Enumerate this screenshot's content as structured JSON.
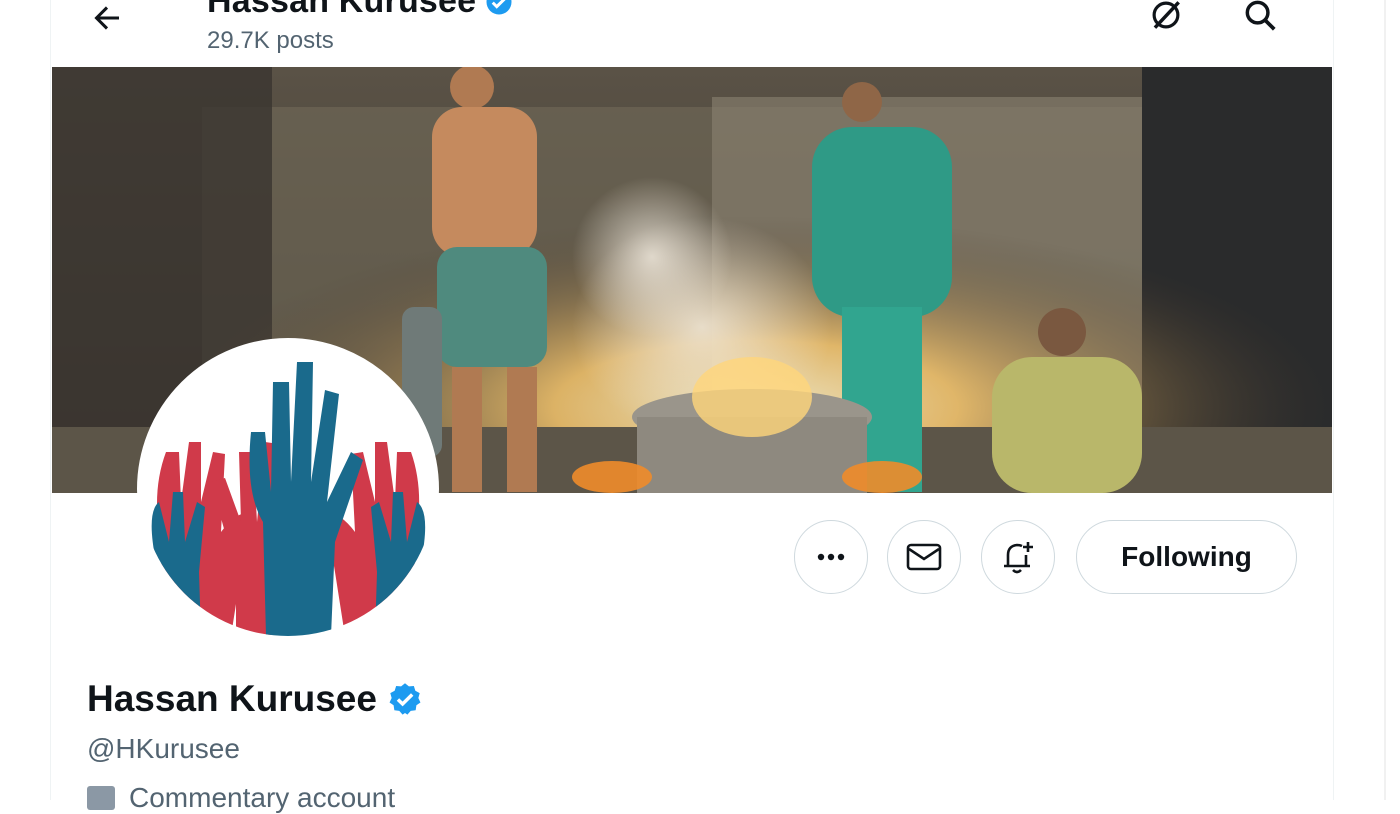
{
  "header": {
    "name": "Hassan Kurusee",
    "posts": "29.7K posts"
  },
  "actions": {
    "following_label": "Following"
  },
  "profile": {
    "name": "Hassan Kurusee",
    "handle": "@HKurusee",
    "label": "Commentary account",
    "verified": true
  },
  "colors": {
    "verified_badge": "#1d9bf0",
    "text_primary": "#0f1419",
    "text_secondary": "#536471",
    "border": "#cfd9de",
    "avatar_blue": "#1a6a8c",
    "avatar_red": "#d03a4a"
  },
  "icons": {
    "back": "arrow-left-icon",
    "grok": "grok-icon",
    "search": "search-icon",
    "more": "more-icon",
    "message": "envelope-icon",
    "notify": "bell-plus-icon",
    "verified": "verified-badge-icon"
  }
}
